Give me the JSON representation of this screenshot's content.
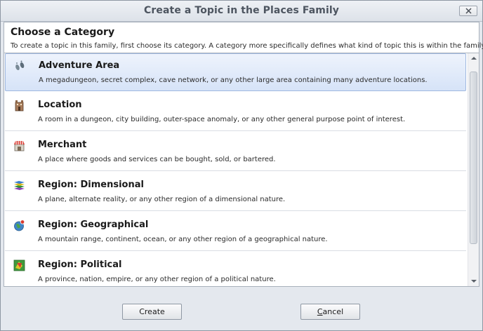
{
  "window": {
    "title": "Create a Topic in the Places Family"
  },
  "header": {
    "heading": "Choose a Category",
    "subheading": "To create a topic in this family, first choose its category. A category more specifically defines what kind of topic this is within the family."
  },
  "categories": [
    {
      "title": "Adventure Area",
      "description": "A megadungeon, secret complex, cave network, or any other large area containing many adventure locations.",
      "icon": "footprints-icon",
      "selected": true
    },
    {
      "title": "Location",
      "description": "A room in a dungeon, city building, outer-space anomaly, or any other general purpose point of interest.",
      "icon": "building-icon",
      "selected": false
    },
    {
      "title": "Merchant",
      "description": "A place where goods and services can be bought, sold, or bartered.",
      "icon": "shop-icon",
      "selected": false
    },
    {
      "title": "Region: Dimensional",
      "description": "A plane, alternate reality, or any other region of a dimensional nature.",
      "icon": "layers-icon",
      "selected": false
    },
    {
      "title": "Region: Geographical",
      "description": "A mountain range, continent, ocean, or any other region of a geographical nature.",
      "icon": "globe-icon",
      "selected": false
    },
    {
      "title": "Region: Political",
      "description": "A province, nation, empire, or any other region of a political nature.",
      "icon": "map-flag-icon",
      "selected": false
    }
  ],
  "buttons": {
    "create": "Create",
    "cancel_accel": "C",
    "cancel_rest": "ancel"
  },
  "colors": {
    "selection_bg": "#d6e3f8",
    "selection_border": "#9fb8e0",
    "window_bg": "#e4e8ee"
  }
}
